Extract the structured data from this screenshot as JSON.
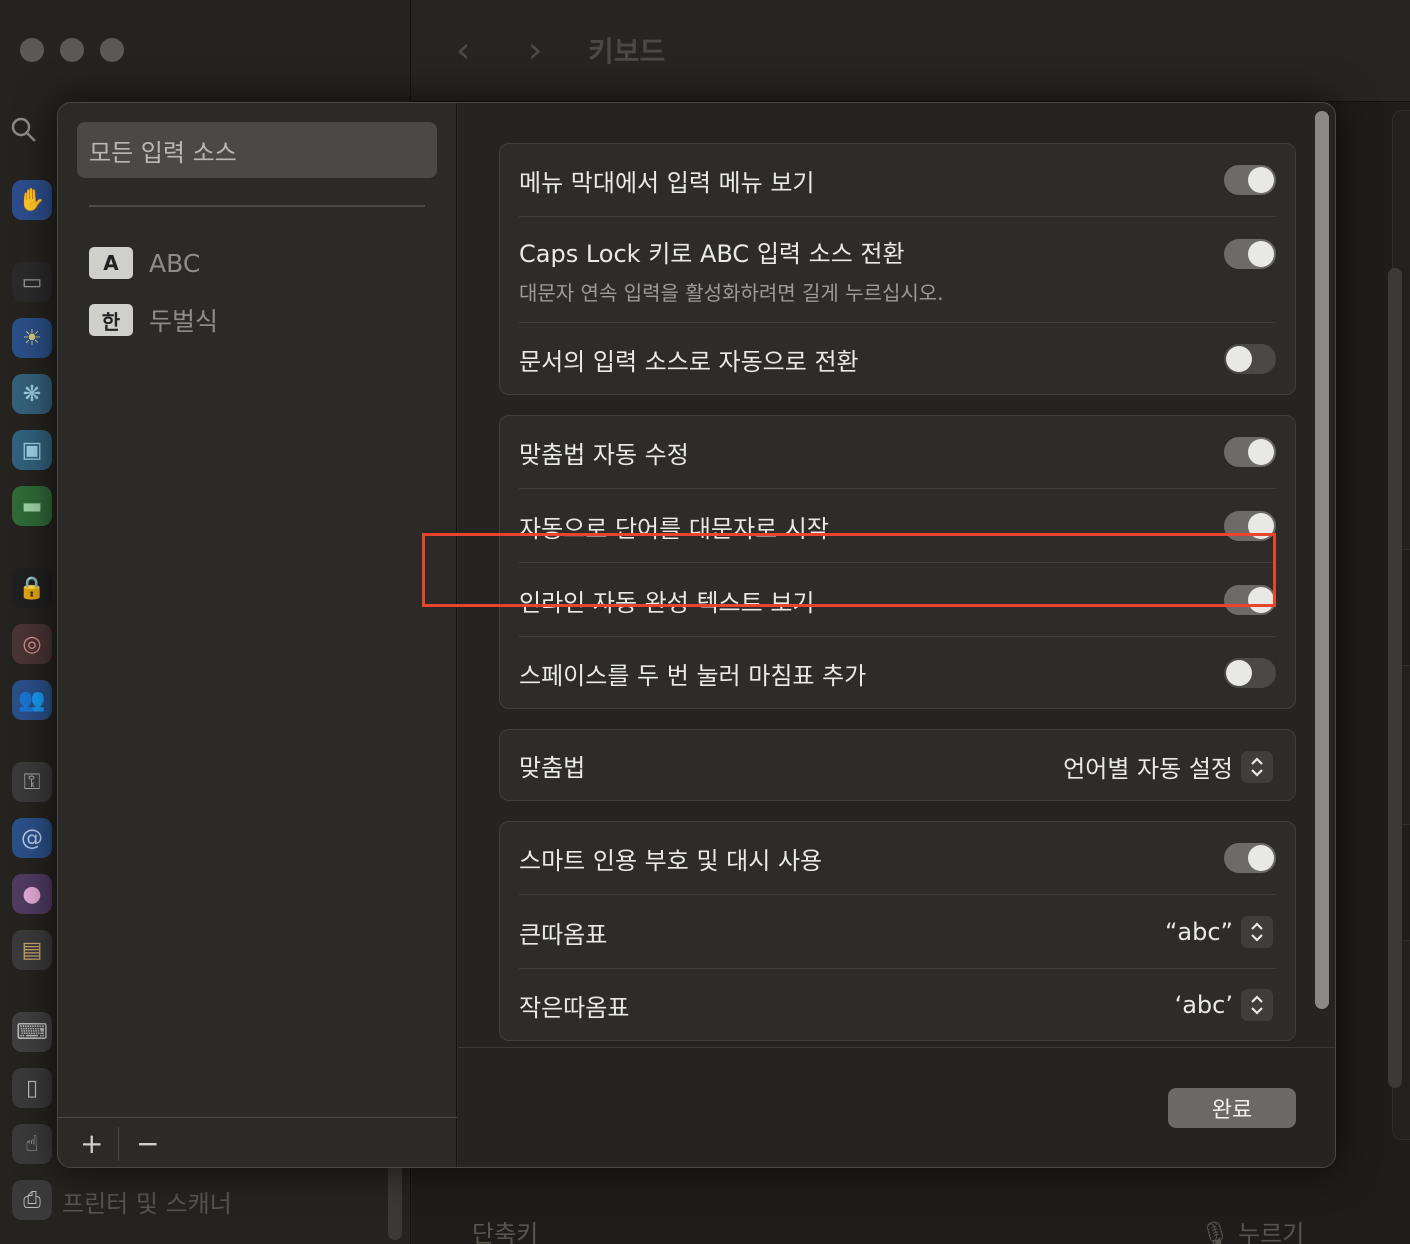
{
  "window": {
    "title": "키보드",
    "nav_back": "‹",
    "nav_forward": "›"
  },
  "background": {
    "sidebar_bottom_label": "프린터 및 스캐너",
    "shortcut_label": "단축키",
    "press_label": "누르기"
  },
  "left_panel": {
    "all_sources_label": "모든 입력 소스",
    "sources": [
      {
        "badge": "A",
        "label": "ABC"
      },
      {
        "badge": "한",
        "label": "두벌식"
      }
    ],
    "add_label": "+",
    "remove_label": "−"
  },
  "settings": {
    "group1": [
      {
        "label": "메뉴 막대에서 입력 메뉴 보기",
        "on": true
      },
      {
        "label": "Caps Lock 키로 ABC 입력 소스 전환",
        "sub": "대문자 연속 입력을 활성화하려면 길게 누르십시오.",
        "on": true
      },
      {
        "label": "문서의 입력 소스로 자동으로 전환",
        "on": false
      }
    ],
    "group2": [
      {
        "label": "맞춤법 자동 수정",
        "on": true
      },
      {
        "label": "자동으로 단어를 대문자로 시작",
        "on": true
      },
      {
        "label": "인라인 자동 완성 텍스트 보기",
        "on": true
      },
      {
        "label": "스페이스를 두 번 눌러 마침표 추가",
        "on": false
      }
    ],
    "spelling": {
      "label": "맞춤법",
      "value": "언어별 자동 설정"
    },
    "group4": {
      "smart_quotes": {
        "label": "스마트 인용 부호 및 대시 사용",
        "on": true
      },
      "double_quotes": {
        "label": "큰따옴표",
        "value": "“abc”"
      },
      "single_quotes": {
        "label": "작은따옴표",
        "value": "‘abc’"
      }
    }
  },
  "done_label": "완료",
  "colors": {
    "highlight": "#e8452c"
  }
}
